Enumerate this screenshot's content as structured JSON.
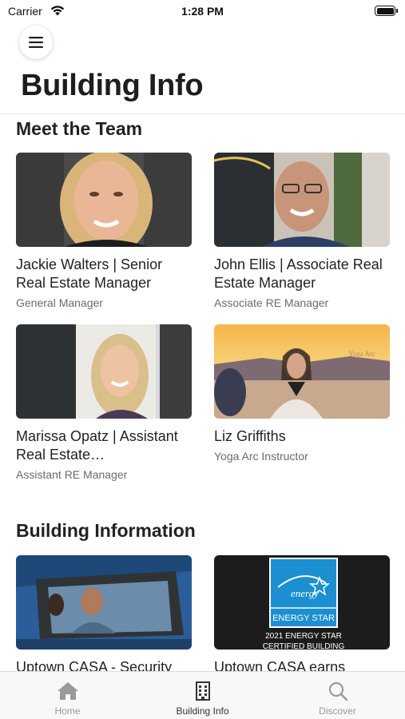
{
  "status_bar": {
    "carrier": "Carrier",
    "time": "1:28 PM"
  },
  "header": {
    "title": "Building Info"
  },
  "sections": {
    "team": {
      "title": "Meet the Team",
      "members": [
        {
          "name": "Jackie Walters | Senior Real Estate Manager",
          "role": "General Manager"
        },
        {
          "name": "John Ellis | Associate Real Estate Manager",
          "role": "Associate RE Manager"
        },
        {
          "name": "Marissa Opatz | Assistant Real Estate…",
          "role": "Assistant RE Manager"
        },
        {
          "name": "Liz Griffiths",
          "role": "Yoga Arc Instructor"
        }
      ]
    },
    "building": {
      "title": "Building Information",
      "items": [
        {
          "title": "Uptown CASA - Security"
        },
        {
          "title": "Uptown CASA earns"
        }
      ],
      "energy_badge": {
        "line1": "ENERGY STAR",
        "line2": "2021 ENERGY STAR",
        "line3": "CERTIFIED BUILDING"
      }
    },
    "yoga_watermark": {
      "brand": "Yoga Arc",
      "name": "Liz Griffiths"
    }
  },
  "tab_bar": {
    "tabs": [
      {
        "label": "Home",
        "icon": "home-icon"
      },
      {
        "label": "Building Info",
        "icon": "building-icon"
      },
      {
        "label": "Discover",
        "icon": "search-icon"
      }
    ],
    "active_index": 1
  },
  "colors": {
    "accent_tab": "#333333",
    "inactive_tab": "#9a9a9a",
    "energy_blue": "#1b8fd1"
  }
}
